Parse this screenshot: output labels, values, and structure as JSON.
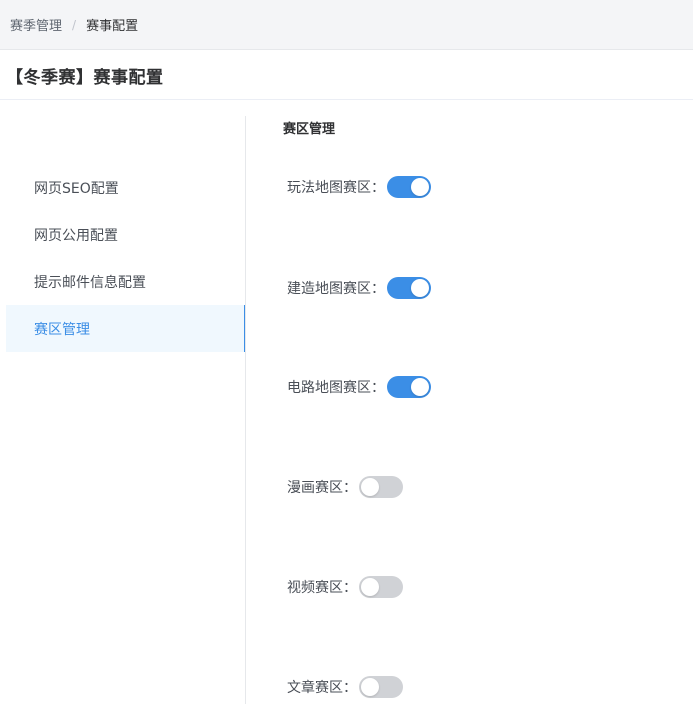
{
  "breadcrumb": {
    "items": [
      "赛季管理",
      "赛事配置"
    ],
    "separator": "/"
  },
  "page": {
    "title": "【冬季赛】赛事配置"
  },
  "sidebar": {
    "items": [
      {
        "label": "网页SEO配置",
        "active": false
      },
      {
        "label": "网页公用配置",
        "active": false
      },
      {
        "label": "提示邮件信息配置",
        "active": false
      },
      {
        "label": "赛区管理",
        "active": true
      }
    ]
  },
  "main": {
    "section_title": "赛区管理",
    "switches": [
      {
        "label": "玩法地图赛区：",
        "on": true
      },
      {
        "label": "建造地图赛区：",
        "on": true
      },
      {
        "label": "电路地图赛区：",
        "on": true
      },
      {
        "label": "漫画赛区：",
        "on": false
      },
      {
        "label": "视频赛区：",
        "on": false
      },
      {
        "label": "文章赛区：",
        "on": false
      }
    ]
  },
  "colors": {
    "accent": "#3b8ee6",
    "switch_off": "#d0d2d6",
    "active_bg": "#f0f8fe"
  }
}
